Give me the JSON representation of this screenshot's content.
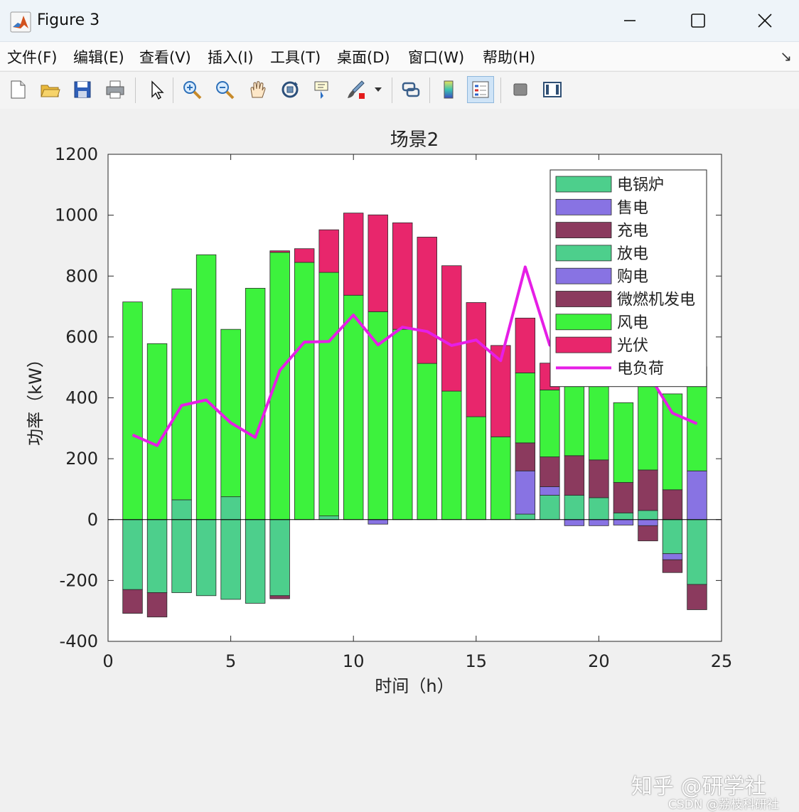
{
  "window": {
    "title": "Figure 3"
  },
  "menu": [
    "文件(F)",
    "编辑(E)",
    "查看(V)",
    "插入(I)",
    "工具(T)",
    "桌面(D)",
    "窗口(W)",
    "帮助(H)"
  ],
  "toolbar": [
    "new-file-icon",
    "open-folder-icon",
    "save-icon",
    "print-icon",
    "pointer-icon",
    "zoom-in-icon",
    "zoom-out-icon",
    "pan-icon",
    "rotate-3d-icon",
    "data-cursor-icon",
    "brush-icon",
    "link-plot-icon",
    "colorbar-icon",
    "legend-icon",
    "hide-plot-tools-icon",
    "show-plot-tools-icon"
  ],
  "chart_data": {
    "type": "bar",
    "stacked": true,
    "title": "场景2",
    "xlabel": "时间（h）",
    "ylabel": "功率（kW）",
    "xlim": [
      0,
      25
    ],
    "ylim": [
      -400,
      1200
    ],
    "xticks": [
      0,
      5,
      10,
      15,
      20,
      25
    ],
    "yticks": [
      -400,
      -200,
      0,
      200,
      400,
      600,
      800,
      1000,
      1200
    ],
    "legend_position": "top-right",
    "categories": [
      1,
      2,
      3,
      4,
      5,
      6,
      7,
      8,
      9,
      10,
      11,
      12,
      13,
      14,
      15,
      16,
      17,
      18,
      19,
      20,
      21,
      22,
      23,
      24
    ],
    "series": [
      {
        "name": "电锅炉",
        "color": "#4dcf8c",
        "values": [
          -230,
          -240,
          -240,
          -250,
          -262,
          -275,
          -250,
          0,
          0,
          0,
          0,
          0,
          0,
          0,
          0,
          0,
          0,
          0,
          0,
          0,
          0,
          0,
          -112,
          -213
        ]
      },
      {
        "name": "售电",
        "color": "#8873e3",
        "values": [
          0,
          0,
          0,
          0,
          0,
          0,
          0,
          0,
          0,
          0,
          -15,
          0,
          0,
          0,
          0,
          0,
          0,
          0,
          -20,
          -20,
          -18,
          -20,
          -20,
          0
        ]
      },
      {
        "name": "充电",
        "color": "#8b3a5e",
        "values": [
          -78,
          -80,
          0,
          0,
          0,
          0,
          -10,
          0,
          0,
          0,
          0,
          0,
          0,
          0,
          0,
          0,
          0,
          0,
          0,
          0,
          0,
          -50,
          -42,
          -83
        ]
      },
      {
        "name": "放电",
        "color": "#4dcf8c",
        "values": [
          0,
          0,
          65,
          0,
          75,
          0,
          0,
          0,
          12,
          0,
          0,
          0,
          0,
          0,
          0,
          0,
          18,
          80,
          80,
          72,
          22,
          30,
          0,
          0
        ]
      },
      {
        "name": "购电",
        "color": "#8873e3",
        "values": [
          0,
          0,
          0,
          0,
          0,
          0,
          0,
          0,
          0,
          0,
          0,
          0,
          0,
          0,
          0,
          0,
          142,
          28,
          0,
          0,
          0,
          0,
          0,
          160
        ]
      },
      {
        "name": "微燃机发电",
        "color": "#8b3a5e",
        "values": [
          0,
          0,
          0,
          0,
          0,
          0,
          0,
          0,
          0,
          0,
          0,
          0,
          0,
          0,
          0,
          0,
          92,
          98,
          130,
          124,
          100,
          133,
          98,
          0
        ]
      },
      {
        "name": "风电",
        "color": "#3df23d",
        "values": [
          715,
          578,
          693,
          870,
          550,
          760,
          878,
          845,
          800,
          737,
          683,
          625,
          513,
          422,
          338,
          272,
          230,
          220,
          233,
          250,
          262,
          282,
          315,
          342
        ]
      },
      {
        "name": "光伏",
        "color": "#e8266c",
        "values": [
          0,
          0,
          0,
          0,
          0,
          0,
          5,
          45,
          140,
          270,
          318,
          350,
          415,
          412,
          375,
          300,
          180,
          88,
          18,
          0,
          0,
          0,
          0,
          0
        ]
      }
    ],
    "line": {
      "name": "电负荷",
      "color": "#e61ee6",
      "values": [
        278,
        243,
        375,
        393,
        318,
        270,
        490,
        583,
        585,
        672,
        574,
        632,
        618,
        572,
        590,
        522,
        830,
        573,
        548,
        545,
        455,
        480,
        350,
        315
      ]
    }
  }
}
